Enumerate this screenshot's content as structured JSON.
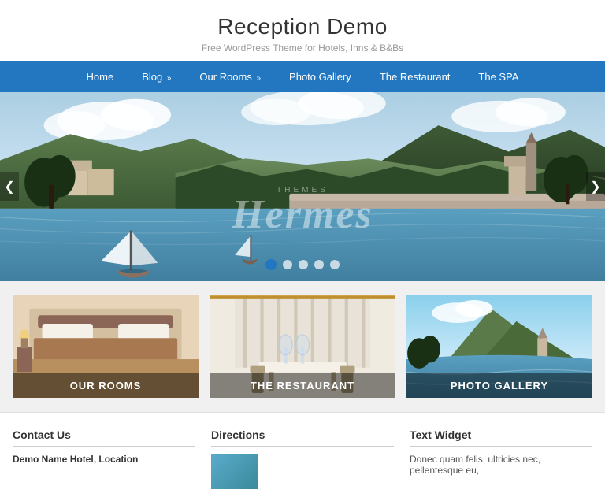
{
  "site": {
    "title": "Reception Demo",
    "subtitle": "Free WordPress Theme for Hotels, Inns & B&Bs"
  },
  "nav": {
    "items": [
      {
        "label": "Home",
        "has_arrow": false
      },
      {
        "label": "Blog",
        "has_arrow": true
      },
      {
        "label": "Our Rooms",
        "has_arrow": true
      },
      {
        "label": "Photo Gallery",
        "has_arrow": false
      },
      {
        "label": "The Restaurant",
        "has_arrow": false
      },
      {
        "label": "The SPA",
        "has_arrow": false
      }
    ]
  },
  "slider": {
    "dots": 5,
    "active_dot": 0,
    "left_arrow": "❮",
    "right_arrow": "❯",
    "watermark_top": "THEMES",
    "watermark_main": "Hermes"
  },
  "feature_boxes": [
    {
      "id": "rooms",
      "label": "OUR ROOMS"
    },
    {
      "id": "restaurant",
      "label": "THE RESTAURANT"
    },
    {
      "id": "gallery",
      "label": "PHOTO GALLERY"
    }
  ],
  "widgets": [
    {
      "id": "contact",
      "title": "Contact Us",
      "content": "Demo Name Hotel, Location"
    },
    {
      "id": "directions",
      "title": "Directions",
      "content": ""
    },
    {
      "id": "text",
      "title": "Text Widget",
      "content": "Donec quam felis, ultricies nec, pellentesque eu,"
    }
  ]
}
